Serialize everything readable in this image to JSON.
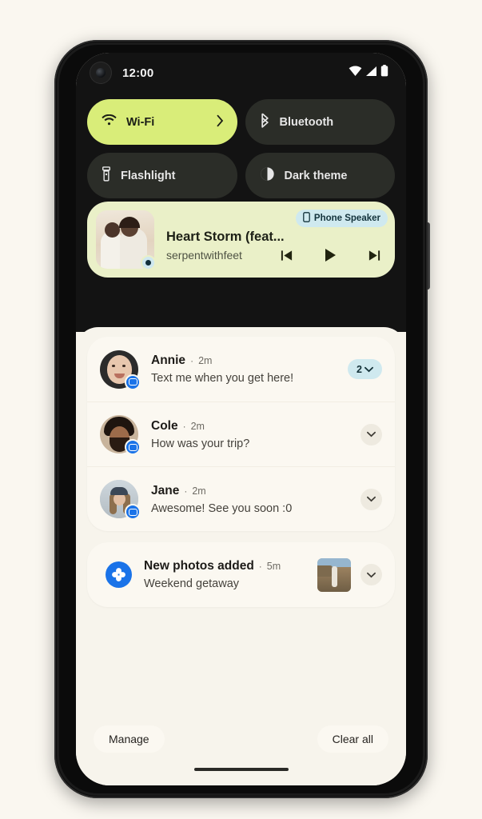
{
  "status_bar": {
    "clock": "12:00",
    "icons": [
      "wifi-icon",
      "cell-signal-icon",
      "battery-icon"
    ]
  },
  "quick_settings": {
    "tiles": [
      {
        "label": "Wi-Fi",
        "icon": "wifi-icon",
        "active": true,
        "has_chevron": true
      },
      {
        "label": "Bluetooth",
        "icon": "bluetooth-icon",
        "active": false,
        "has_chevron": false
      },
      {
        "label": "Flashlight",
        "icon": "flashlight-icon",
        "active": false,
        "has_chevron": false
      },
      {
        "label": "Dark theme",
        "icon": "contrast-icon",
        "active": false,
        "has_chevron": false
      }
    ],
    "active_color": "#d9ed79",
    "inactive_color": "#2b2d28"
  },
  "media_player": {
    "title": "Heart Storm (feat...",
    "artist": "serpentwithfeet",
    "output_chip": {
      "label": "Phone Speaker",
      "icon": "phone-icon",
      "color": "#cfe9ef"
    },
    "album_art_name": "album-art",
    "controls": [
      {
        "name": "previous-track-button",
        "icon": "skip-previous-icon"
      },
      {
        "name": "play-button",
        "icon": "play-icon"
      },
      {
        "name": "next-track-button",
        "icon": "skip-next-icon"
      }
    ],
    "card_color": "#eaf0c8"
  },
  "notifications": {
    "conversations": [
      {
        "name": "Annie",
        "separator": "·",
        "time": "2m",
        "message": "Text me when you get here!",
        "app_icon": "messages-icon",
        "count_badge": "2",
        "has_count": true
      },
      {
        "name": "Cole",
        "separator": "·",
        "time": "2m",
        "message": "How was your trip?",
        "app_icon": "messages-icon",
        "count_badge": "",
        "has_count": false
      },
      {
        "name": "Jane",
        "separator": "·",
        "time": "2m",
        "message": "Awesome! See you soon :0",
        "app_icon": "messages-icon",
        "count_badge": "",
        "has_count": false
      }
    ],
    "photos": {
      "title": "New photos added",
      "separator": "·",
      "time": "5m",
      "subtitle": "Weekend getaway",
      "app_icon": "google-photos-icon",
      "thumbnail_name": "photo-thumbnail"
    },
    "count_badge_color": "#cfe9ef"
  },
  "shade_actions": {
    "manage_label": "Manage",
    "clear_all_label": "Clear all"
  },
  "theme": {
    "page_background": "#faf7f0",
    "shade_background": "#131313",
    "notification_background": "#f7f4ec",
    "card_background": "#fbf8f1",
    "accent_blue": "#1a73e8"
  }
}
